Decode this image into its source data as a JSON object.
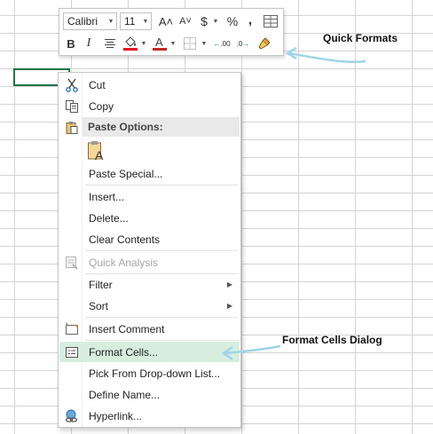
{
  "mini_toolbar": {
    "font_name": "Calibri",
    "font_size": "11",
    "increase_font_icon": "A˄",
    "decrease_font_icon": "A˅",
    "currency_icon": "$",
    "percent_icon": "%",
    "comma_icon": ",",
    "bold_icon": "B",
    "italic_icon": "I",
    "font_color_icon": "A",
    "increase_decimal": ".00",
    "decrease_decimal": ".0",
    "fill_color": "#e81123",
    "font_color": "#c5281c"
  },
  "context_menu": {
    "cut": "Cut",
    "copy": "Copy",
    "paste_options": "Paste Options:",
    "paste_special": "Paste Special...",
    "insert": "Insert...",
    "delete": "Delete...",
    "clear_contents": "Clear Contents",
    "quick_analysis": "Quick Analysis",
    "filter": "Filter",
    "sort": "Sort",
    "insert_comment": "Insert Comment",
    "format_cells": "Format Cells...",
    "pick_from_list": "Pick From Drop-down List...",
    "define_name": "Define Name...",
    "hyperlink": "Hyperlink..."
  },
  "annotations": {
    "quick_formats": "Quick Formats",
    "format_cells_dialog": "Format Cells Dialog"
  },
  "colors": {
    "accent_green": "#217346",
    "highlight": "#d7eedf",
    "annotation_arrow": "#9fd4e6"
  }
}
